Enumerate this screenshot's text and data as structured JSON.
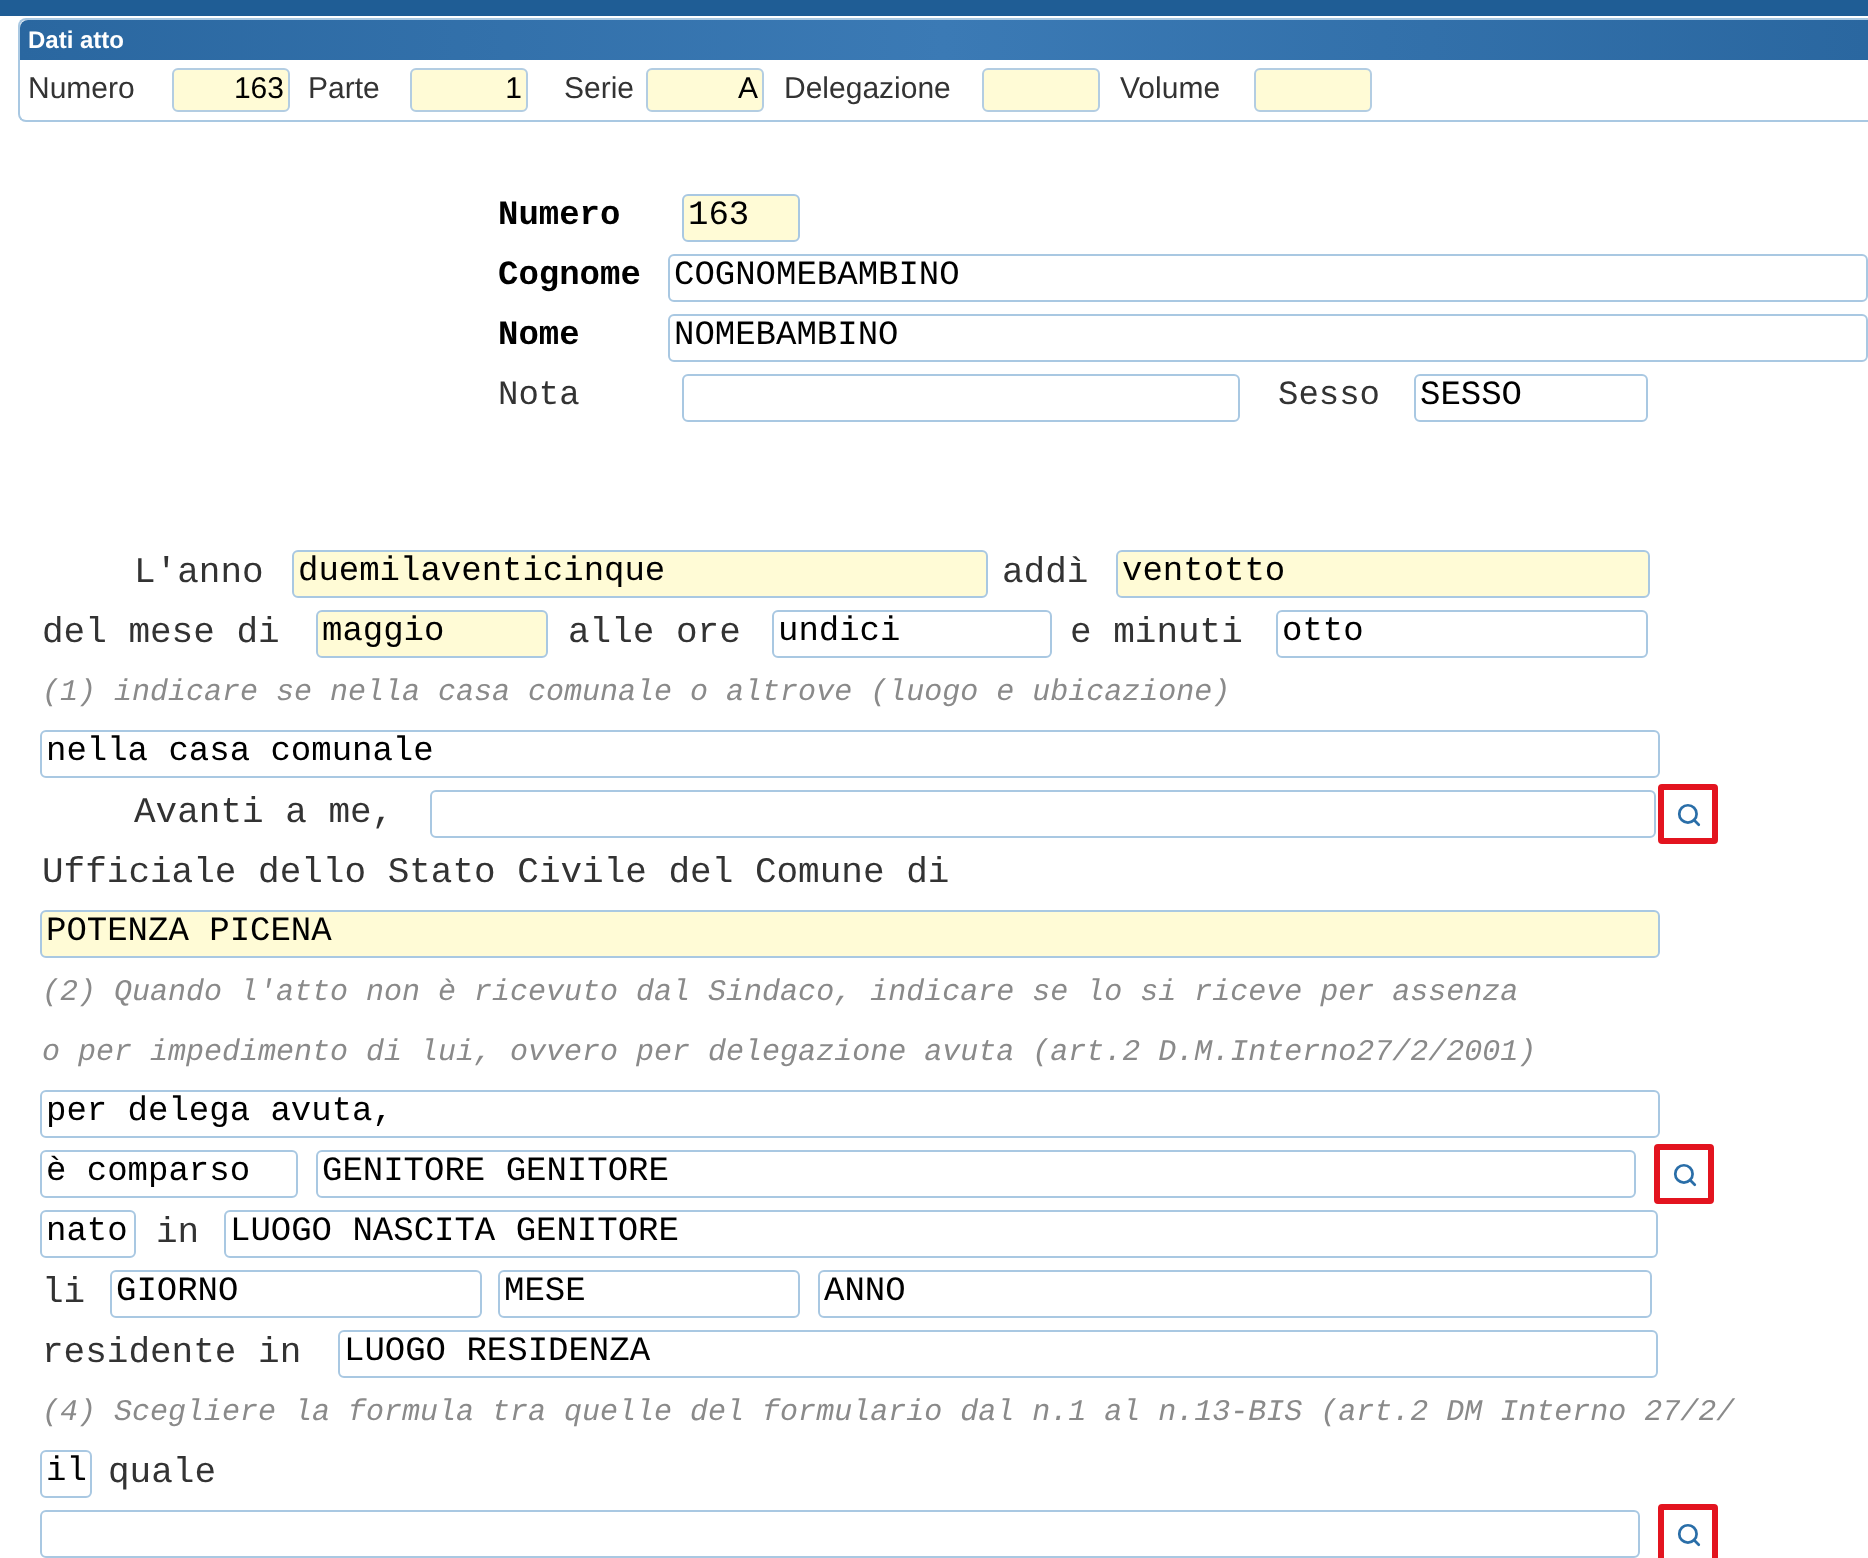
{
  "header": {
    "title": "Dati atto",
    "fields": [
      {
        "label": "Numero",
        "value": "163",
        "highlighted": true
      },
      {
        "label": "Parte",
        "value": "1",
        "highlighted": true
      },
      {
        "label": "Serie",
        "value": "A",
        "highlighted": true
      },
      {
        "label": "Delegazione",
        "highlighted": true
      },
      {
        "label": "Volume",
        "highlighted": true
      }
    ]
  },
  "identity": [
    {
      "label": "Numero",
      "required": true,
      "value": "163",
      "highlighted": true
    },
    {
      "label": "Cognome",
      "required": true,
      "value": "COGNOMEBAMBINO",
      "highlighted": false
    },
    {
      "label": "Nome",
      "required": true,
      "value": "NOMEBAMBINO",
      "highlighted": false
    },
    {
      "label": "Nota",
      "required": false,
      "highlighted": false,
      "extra": {
        "label": "Sesso",
        "value": "SESSO",
        "highlighted": false
      }
    }
  ],
  "body": [
    {
      "items": [
        {
          "kind": "label",
          "text": "L'anno"
        },
        {
          "kind": "field",
          "value": "duemilaventicinque",
          "highlighted": true
        },
        {
          "kind": "label",
          "text": "addì"
        },
        {
          "kind": "field",
          "value": "ventotto",
          "highlighted": true
        }
      ]
    },
    {
      "items": [
        {
          "kind": "label",
          "text": "del mese di"
        },
        {
          "kind": "field",
          "value": "maggio",
          "highlighted": true
        },
        {
          "kind": "label",
          "text": "alle ore"
        },
        {
          "kind": "field",
          "value": "undici",
          "highlighted": false
        },
        {
          "kind": "label",
          "text": "e minuti"
        },
        {
          "kind": "field",
          "value": "otto",
          "highlighted": false
        }
      ]
    },
    {
      "items": [
        {
          "kind": "note",
          "text": "(1) indicare se nella casa comunale o altrove (luogo e ubicazione)"
        }
      ]
    },
    {
      "items": [
        {
          "kind": "field",
          "value": "nella casa comunale",
          "highlighted": false
        }
      ]
    },
    {
      "items": [
        {
          "kind": "label",
          "text": "Avanti a me,"
        },
        {
          "kind": "field",
          "highlighted": false
        },
        {
          "kind": "search",
          "highlighted": true
        }
      ]
    },
    {
      "items": [
        {
          "kind": "label",
          "text": "Ufficiale dello Stato Civile del Comune di"
        }
      ]
    },
    {
      "items": [
        {
          "kind": "field",
          "value": "POTENZA PICENA",
          "highlighted": true
        }
      ]
    },
    {
      "items": [
        {
          "kind": "note",
          "text": "(2) Quando l'atto non è ricevuto dal Sindaco, indicare se lo si riceve per assenza"
        }
      ]
    },
    {
      "items": [
        {
          "kind": "note",
          "text": "o per impedimento di lui, ovvero per delegazione avuta (art.2 D.M.Interno27/2/2001)"
        }
      ]
    },
    {
      "items": [
        {
          "kind": "field",
          "value": "per delega avuta,",
          "highlighted": false
        }
      ]
    },
    {
      "items": [
        {
          "kind": "field",
          "value": "è comparso",
          "highlighted": false
        },
        {
          "kind": "field",
          "value": "GENITORE GENITORE",
          "highlighted": false
        },
        {
          "kind": "search",
          "highlighted": true
        }
      ]
    },
    {
      "items": [
        {
          "kind": "field",
          "value": "nato",
          "highlighted": false
        },
        {
          "kind": "label",
          "text": "in"
        },
        {
          "kind": "field",
          "value": "LUOGO NASCITA GENITORE",
          "highlighted": false
        }
      ]
    },
    {
      "items": [
        {
          "kind": "label",
          "text": "li"
        },
        {
          "kind": "field",
          "value": "GIORNO",
          "highlighted": false
        },
        {
          "kind": "field",
          "value": "MESE",
          "highlighted": false
        },
        {
          "kind": "field",
          "value": "ANNO",
          "highlighted": false
        }
      ]
    },
    {
      "items": [
        {
          "kind": "label",
          "text": "residente in"
        },
        {
          "kind": "field",
          "value": "LUOGO RESIDENZA",
          "highlighted": false
        }
      ]
    },
    {
      "items": [
        {
          "kind": "note",
          "text": "(4) Scegliere la formula tra quelle del formulario dal n.1 al n.13-BIS (art.2 DM Interno 27/2/"
        }
      ]
    },
    {
      "items": [
        {
          "kind": "field",
          "value": "il",
          "highlighted": false
        },
        {
          "kind": "label",
          "text": "quale"
        }
      ]
    },
    {
      "items": [
        {
          "kind": "field",
          "highlighted": false
        },
        {
          "kind": "search",
          "highlighted": true
        }
      ]
    }
  ]
}
